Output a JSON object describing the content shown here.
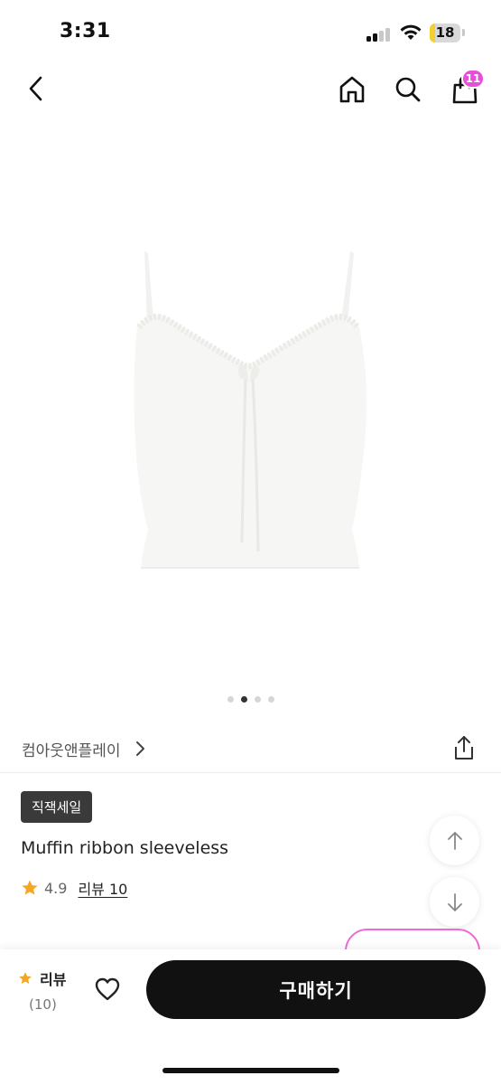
{
  "status_bar": {
    "time": "3:31",
    "battery": "18",
    "battery_level_percent": 18,
    "battery_color": "#f5cf2e"
  },
  "nav": {
    "back_icon": "chevron-left-icon",
    "home_icon": "home-icon",
    "search_icon": "search-icon",
    "cart_icon": "shopping-bag-icon",
    "cart_count": "11",
    "badge_color": "#e74fd8"
  },
  "gallery": {
    "image_count": 4,
    "active_index": 1
  },
  "product": {
    "brand": "컴아웃앤플레이",
    "sale_badge": "직잭세일",
    "name": "Muffin ribbon sleeveless",
    "rating": "4.9",
    "review_label": "리뷰 10",
    "share_icon": "share-icon",
    "star_color": "#f5a623"
  },
  "scroll": {
    "up_icon": "arrow-up-icon",
    "down_icon": "arrow-down-icon"
  },
  "bottom_bar": {
    "review_label": "리뷰",
    "review_count": "(10)",
    "wishlist_icon": "heart-icon",
    "buy_label": "구매하기"
  }
}
